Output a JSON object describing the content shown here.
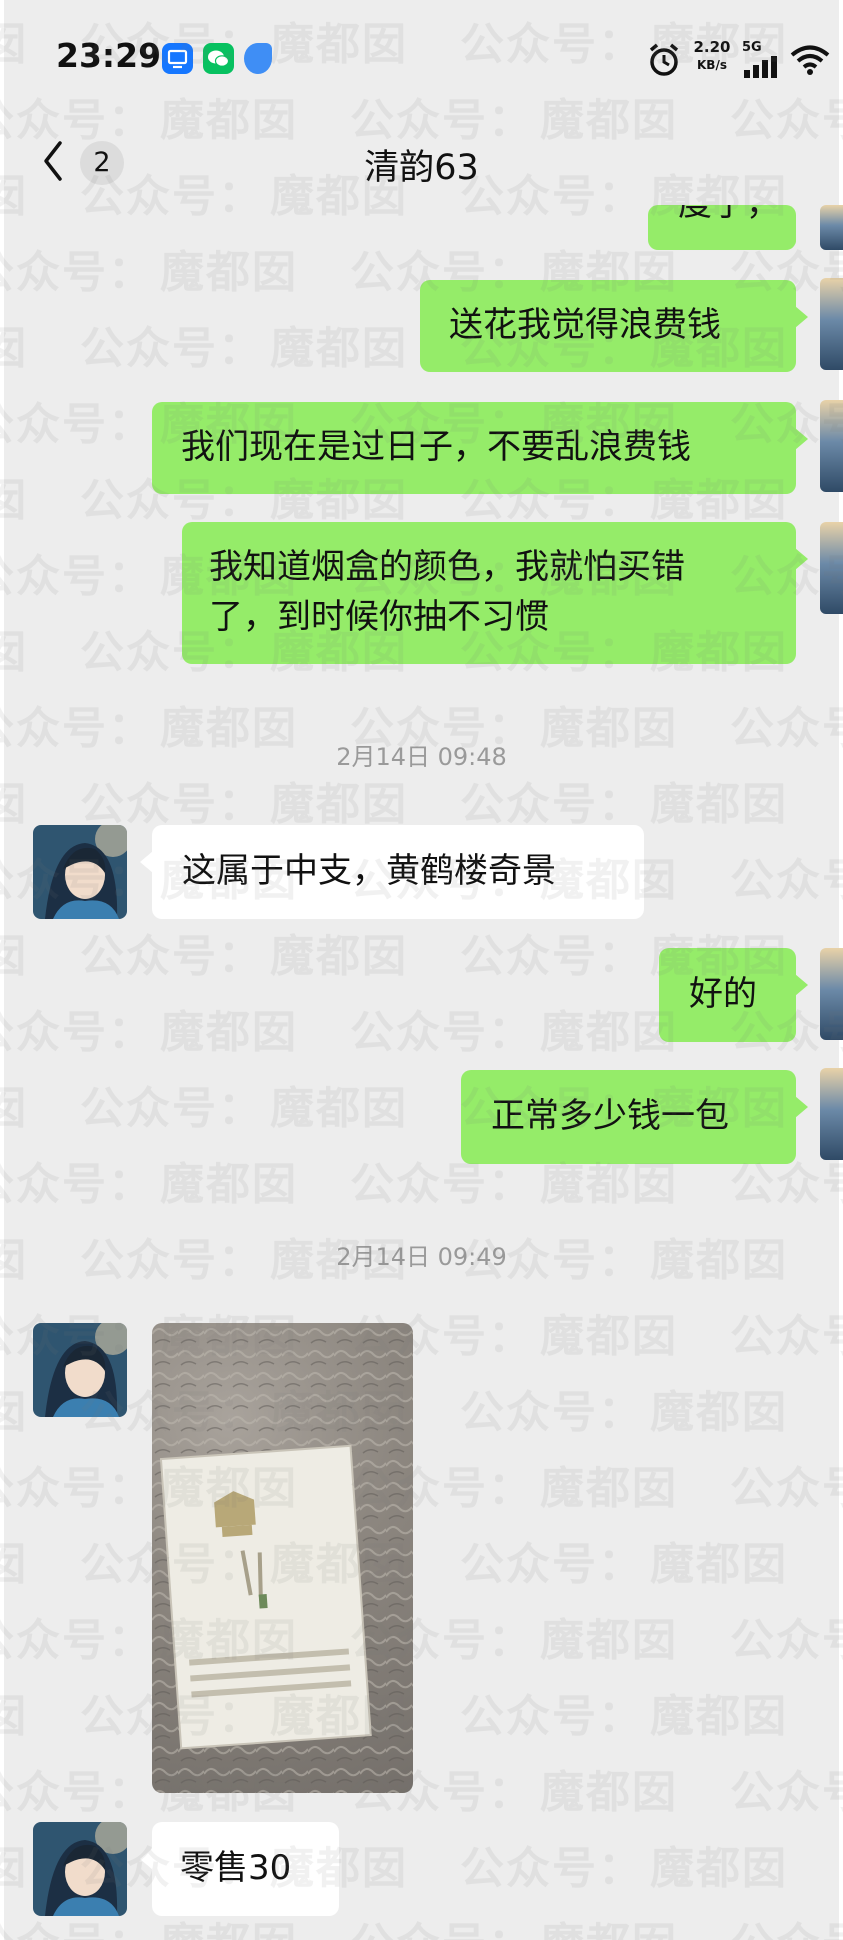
{
  "status_bar": {
    "time": "23:29",
    "net_speed_value": "2.20",
    "net_speed_unit": "KB/s",
    "network_type": "5G",
    "icons": [
      "screen-mirror-icon",
      "wechat-icon",
      "assistant-icon",
      "alarm-icon",
      "signal-icon",
      "wifi-icon"
    ]
  },
  "header": {
    "back_icon": "chevron-left-icon",
    "unread_count": "2",
    "title": "清韵63"
  },
  "messages": [
    {
      "side": "out",
      "text": "度了，"
    },
    {
      "side": "out",
      "text": "送花我觉得浪费钱"
    },
    {
      "side": "out",
      "text": "我们现在是过日子，不要乱浪费钱"
    },
    {
      "side": "out",
      "text_line1": "我知道烟盒的颜色，我就怕买错",
      "text_line2": "了，到时候你抽不习惯"
    },
    {
      "type": "timestamp",
      "text": "2月14日 09:48"
    },
    {
      "side": "in",
      "text": "这属于中支，黄鹤楼奇景"
    },
    {
      "side": "out",
      "text": "好的"
    },
    {
      "side": "out",
      "text": "正常多少钱一包"
    },
    {
      "type": "timestamp",
      "text": "2月14日 09:49"
    },
    {
      "side": "in",
      "type": "image",
      "description_icon": "cigarette-pack-photo-icon"
    },
    {
      "side": "in",
      "text": "零售30"
    }
  ],
  "watermark": {
    "text_a": "魔都囡",
    "text_b": "公众号："
  },
  "colors": {
    "background": "#ededed",
    "bubble_out": "#95ec69",
    "bubble_in": "#ffffff",
    "timestamp": "#9a9a9a"
  }
}
